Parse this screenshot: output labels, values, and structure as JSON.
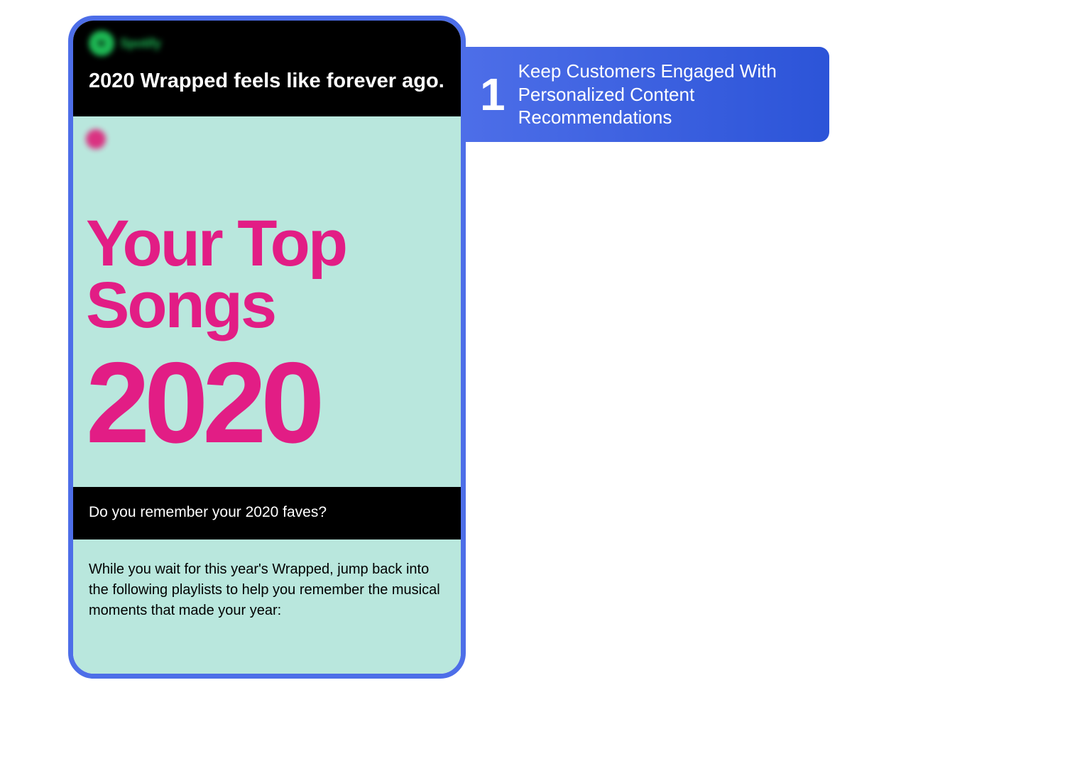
{
  "callout": {
    "number": "1",
    "text": "Keep Customers Engaged With Personalized Content Recommendations"
  },
  "email": {
    "brand_name": "Spotify",
    "headline": "2020 Wrapped feels like forever ago.",
    "hero_title": "Your Top Songs",
    "hero_year": "2020",
    "subheadline": "Do you remember your 2020 faves?",
    "body": "While you wait for this year's Wrapped, jump back into the following playlists to help you remember the musical moments that made your year:"
  },
  "colors": {
    "frame_border": "#4d6ee8",
    "hero_bg": "#b9e7dd",
    "accent_pink": "#e21d85",
    "callout_gradient_start": "#4d6ee8",
    "callout_gradient_end": "#2c54d8"
  }
}
